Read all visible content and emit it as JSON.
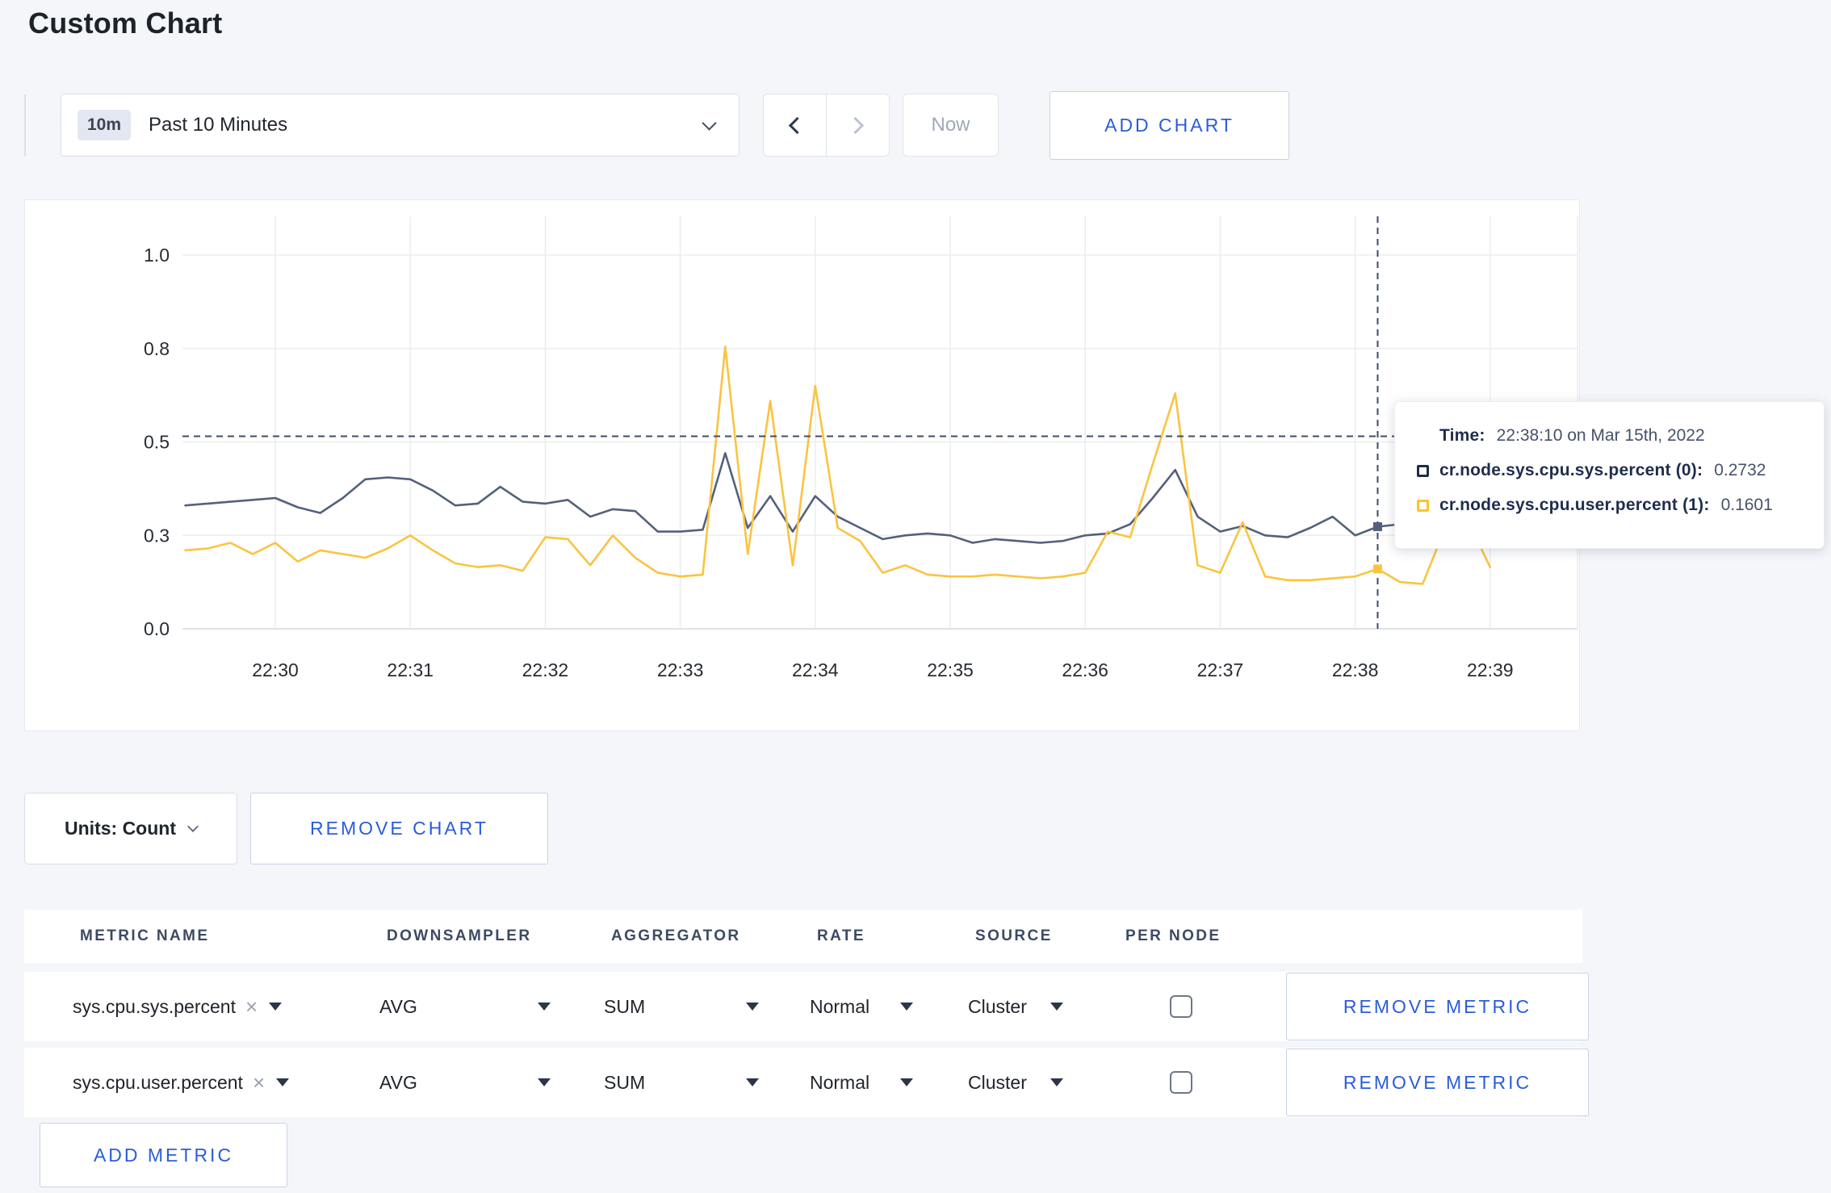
{
  "page_title": "Custom Chart",
  "toolbar": {
    "time_badge": "10m",
    "time_label": "Past 10 Minutes",
    "now_label": "Now",
    "add_chart_label": "ADD CHART"
  },
  "chart_data": {
    "type": "line",
    "title": "",
    "x_tick_labels": [
      "22:30",
      "22:31",
      "22:32",
      "22:33",
      "22:34",
      "22:35",
      "22:36",
      "22:37",
      "22:38",
      "22:39"
    ],
    "y_tick_labels": [
      "0.0",
      "0.3",
      "0.5",
      "0.8",
      "1.0"
    ],
    "y_tick_values": [
      0,
      0.25,
      0.5,
      0.75,
      1.0
    ],
    "ylim": [
      0,
      1
    ],
    "grid": true,
    "x_start_seconds": -40,
    "x_step_seconds": 10,
    "series": [
      {
        "name": "cr.node.sys.cpu.sys.percent (0)",
        "color": "#54617C",
        "values": [
          0.33,
          0.335,
          0.34,
          0.345,
          0.35,
          0.325,
          0.31,
          0.35,
          0.4,
          0.405,
          0.4,
          0.37,
          0.33,
          0.335,
          0.38,
          0.34,
          0.335,
          0.345,
          0.3,
          0.32,
          0.315,
          0.26,
          0.26,
          0.265,
          0.47,
          0.27,
          0.355,
          0.26,
          0.355,
          0.3,
          0.27,
          0.24,
          0.25,
          0.255,
          0.25,
          0.23,
          0.24,
          0.235,
          0.23,
          0.235,
          0.25,
          0.255,
          0.28,
          0.35,
          0.425,
          0.3,
          0.26,
          0.275,
          0.25,
          0.245,
          0.27,
          0.3,
          0.25,
          0.2732,
          0.28,
          0.27,
          0.28,
          0.27,
          0.28
        ]
      },
      {
        "name": "cr.node.sys.cpu.user.percent (1)",
        "color": "#FAC440",
        "values": [
          0.21,
          0.215,
          0.23,
          0.2,
          0.23,
          0.18,
          0.21,
          0.2,
          0.19,
          0.215,
          0.25,
          0.21,
          0.175,
          0.165,
          0.17,
          0.155,
          0.245,
          0.24,
          0.17,
          0.25,
          0.19,
          0.15,
          0.14,
          0.145,
          0.755,
          0.2,
          0.61,
          0.17,
          0.65,
          0.27,
          0.235,
          0.15,
          0.17,
          0.145,
          0.14,
          0.14,
          0.145,
          0.14,
          0.135,
          0.14,
          0.15,
          0.26,
          0.245,
          0.44,
          0.63,
          0.17,
          0.15,
          0.285,
          0.14,
          0.13,
          0.13,
          0.135,
          0.14,
          0.1601,
          0.125,
          0.12,
          0.27,
          0.29,
          0.165
        ]
      }
    ],
    "legend_position": "tooltip",
    "hover": {
      "time_seconds": 490,
      "crosshair_y_value": 0.515,
      "values": [
        0.2732,
        0.1601
      ]
    }
  },
  "tooltip": {
    "time_label": "Time:",
    "time_value": "22:38:10 on Mar 15th, 2022",
    "entries": [
      {
        "label": "cr.node.sys.cpu.sys.percent (0):",
        "value": "0.2732",
        "swatch_color": "#1F2D4D"
      },
      {
        "label": "cr.node.sys.cpu.user.percent (1):",
        "value": "0.1601",
        "swatch_color": "#FFC42C"
      }
    ]
  },
  "chart_footer": {
    "units_label": "Units: Count",
    "remove_chart_label": "REMOVE CHART"
  },
  "metrics_table": {
    "headers": [
      "METRIC NAME",
      "DOWNSAMPLER",
      "AGGREGATOR",
      "RATE",
      "SOURCE",
      "PER NODE"
    ],
    "rows": [
      {
        "metric": "sys.cpu.sys.percent",
        "remove_icon": "×",
        "downsampler": "AVG",
        "aggregator": "SUM",
        "rate": "Normal",
        "source": "Cluster",
        "per_node_checked": false,
        "remove_label": "REMOVE METRIC"
      },
      {
        "metric": "sys.cpu.user.percent",
        "remove_icon": "×",
        "downsampler": "AVG",
        "aggregator": "SUM",
        "rate": "Normal",
        "source": "Cluster",
        "per_node_checked": false,
        "remove_label": "REMOVE METRIC"
      }
    ],
    "add_metric_label": "ADD METRIC"
  }
}
